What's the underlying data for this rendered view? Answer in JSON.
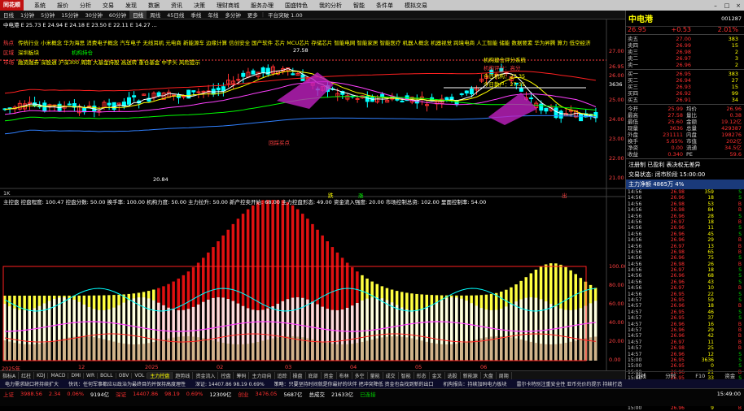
{
  "menubar": {
    "logo": "同花顺",
    "items": [
      "系统",
      "报价",
      "分析",
      "交易",
      "发现",
      "数据",
      "资讯",
      "决策",
      "理财商城",
      "服务办理",
      "国盛特色",
      "我的分析",
      "智能",
      "条件单",
      "模拟交易"
    ],
    "title": "中电港"
  },
  "toolbar": {
    "items": [
      "日线",
      "1分钟",
      "5分钟",
      "15分钟",
      "30分钟",
      "60分钟",
      "日线",
      "周线",
      "45日线",
      "季线",
      "年线",
      "多分钟",
      "更多"
    ],
    "stats": "中电港 E 25.73  E 24.94  E 24.18  E 23.50  E 22.11  E 14.27  ...",
    "status1": "扩: 22.86",
    "status2": "日 22.86",
    "status3": "平台突破 1.00"
  },
  "chart": {
    "labels": {
      "hot": "热点",
      "hot_value": "传统行业 小米概念 华为海思 消费电子概念 汽车电子 无线耳机 元电商 新能源车 边缘计算 信创安全 国产软件 芯片 MCU芯片 存储芯片 智能电网 智能家居 智能医疗 机器人概念 机器视觉 跨境电商 人工智能 储能 数据要素 华为昇腾 算力 低空经济",
      "zone": "区域",
      "zone_value": "深圳板块",
      "mkt": "融资融券 深股通 沪深300 周期 大基金持股 高送转 重仓基金 中字头 风险提示",
      "tag1": "融资融券",
      "tag2": "机构持仓",
      "box_title": "机构建仓评分系统",
      "box_l1": "机构评分：高分",
      "box_l2": "今日机构：27.35",
      "box_l3": "今日散户：27.35",
      "peak": "27.58",
      "low": "20.84",
      "buy_label": "买",
      "sell_label": "卖",
      "mid_label": "回踩买点",
      "scale": "1K",
      "sub_header": "主控盘 控盘程度: 100.47 控盘分数: 50.00 换手率: 100.00 机构力度: 50.00 主力拉升: 50.00 新产控卖开始: 68.00 主力控盘形态: 49.00 资金流入强度: 20.00 市场控制总资: 102.00 里面控制率: 54.00",
      "sub_a": "跌",
      "sub_b": "涨",
      "sub_c": "出"
    },
    "x_labels": [
      "2025年",
      "12",
      "2025",
      "02",
      "03",
      "04",
      "05",
      "06"
    ],
    "y_right": [
      "27.00",
      "26.00",
      "25.00",
      "24.00",
      "23.00",
      "22.00",
      "21.00"
    ],
    "y_right_extra": [
      "26.95",
      "3636"
    ],
    "sub_y": [
      "100.00",
      "80.00",
      "60.00",
      "40.00",
      "20.00",
      "0.00"
    ]
  },
  "bottomtabs": [
    "指标A",
    "红柱",
    "KDJ",
    "MACD",
    "DMI",
    "WR",
    "BOLL",
    "OBV",
    "VOL",
    "主力控盘",
    "趋势线",
    "资金流入",
    "控盘",
    "筹码",
    "主力动向",
    "追踪",
    "操盘",
    "底部",
    "资金",
    "布林",
    "多空",
    "量能",
    "成交",
    "智能",
    "形态",
    "金叉",
    "选股",
    "新能源",
    "大盘",
    "周期"
  ],
  "rightpanel": {
    "name": "中电港",
    "code": "001287",
    "price": "26.95",
    "change": "+0.53",
    "pct": "2.01%",
    "asks": [
      [
        "卖五",
        "27.00",
        "383"
      ],
      [
        "卖四",
        "26.99",
        "15"
      ],
      [
        "卖三",
        "26.98",
        "2"
      ],
      [
        "卖二",
        "26.97",
        "3"
      ],
      [
        "卖一",
        "26.96",
        "2"
      ]
    ],
    "bids": [
      [
        "买一",
        "26.95",
        "383"
      ],
      [
        "买二",
        "26.94",
        "27"
      ],
      [
        "买三",
        "26.93",
        "15"
      ],
      [
        "买四",
        "26.92",
        "99"
      ],
      [
        "买五",
        "26.91",
        "34"
      ]
    ],
    "kv": [
      [
        "今开",
        "25.99",
        "均价",
        "26.96"
      ],
      [
        "最高",
        "27.58",
        "量比",
        "0.38"
      ],
      [
        "最低",
        "25.60",
        "金额",
        "19.12亿"
      ],
      [
        "现量",
        "3636",
        "总量",
        "429387"
      ],
      [
        "外盘",
        "231111",
        "内盘",
        "198276"
      ],
      [
        "换手",
        "5.65%",
        "市值",
        "202亿"
      ],
      [
        "净资",
        "0.00",
        "流通",
        "34.5亿"
      ],
      [
        "收益",
        "0.340",
        "PE",
        "59.6"
      ]
    ],
    "notes": [
      "注册制 已盈利 表决权无差异",
      "交易状态: 闭市阶段 15:00:00",
      "主力净额 4865万 4%"
    ],
    "ticks": [
      [
        "14:56",
        "26.98",
        "359",
        "S"
      ],
      [
        "14:56",
        "26.96",
        "18",
        "S"
      ],
      [
        "14:56",
        "26.98",
        "53",
        "B"
      ],
      [
        "14:56",
        "26.98",
        "84",
        "B"
      ],
      [
        "14:56",
        "26.96",
        "28",
        "S"
      ],
      [
        "14:56",
        "26.97",
        "18",
        "B"
      ],
      [
        "14:56",
        "26.96",
        "11",
        "S"
      ],
      [
        "14:56",
        "26.96",
        "45",
        "S"
      ],
      [
        "14:56",
        "26.96",
        "29",
        "B"
      ],
      [
        "14:56",
        "26.97",
        "13",
        "B"
      ],
      [
        "14:56",
        "26.98",
        "65",
        "B"
      ],
      [
        "14:56",
        "26.96",
        "75",
        "S"
      ],
      [
        "14:56",
        "26.98",
        "26",
        "B"
      ],
      [
        "14:56",
        "26.97",
        "18",
        "S"
      ],
      [
        "14:56",
        "26.96",
        "68",
        "S"
      ],
      [
        "14:56",
        "26.96",
        "43",
        "S"
      ],
      [
        "14:56",
        "26.97",
        "10",
        "B"
      ],
      [
        "14:56",
        "26.95",
        "22",
        "S"
      ],
      [
        "14:57",
        "26.95",
        "59",
        "S"
      ],
      [
        "14:57",
        "26.96",
        "18",
        "B"
      ],
      [
        "14:57",
        "26.95",
        "46",
        "S"
      ],
      [
        "14:57",
        "26.95",
        "37",
        "S"
      ],
      [
        "14:57",
        "26.96",
        "16",
        "B"
      ],
      [
        "14:57",
        "26.96",
        "29",
        "B"
      ],
      [
        "14:57",
        "26.96",
        "42",
        "B"
      ],
      [
        "14:57",
        "26.97",
        "11",
        "B"
      ],
      [
        "14:57",
        "26.98",
        "25",
        "B"
      ],
      [
        "14:57",
        "26.96",
        "12",
        "S"
      ],
      [
        "15:00",
        "26.95",
        "3636",
        "S"
      ],
      [
        "15:00",
        "26.95",
        "0",
        "S"
      ],
      [
        "15:00",
        "26.96",
        "21",
        "B"
      ],
      [
        "15:00",
        "26.95",
        "33",
        "S"
      ],
      [
        "15:00",
        "26.95",
        "22",
        "S"
      ],
      [
        "15:00",
        "26.96",
        "40",
        "B"
      ],
      [
        "15:00",
        "26.95",
        "18",
        "S"
      ],
      [
        "15:00",
        "26.95",
        "27",
        "S"
      ],
      [
        "15:00",
        "26.96",
        "9",
        "B"
      ]
    ],
    "tabs": [
      "日线",
      "分时",
      "F10",
      "资金"
    ]
  },
  "newsbar": [
    "电力需求缺口将持续扩大",
    "快讯：任何军事都应以政治为最终目的并保持高度理性",
    "深证: 14407.86 98.19 0.69%",
    "策略：只要坚持时间就是你最好的伙伴 把冲突降低 资金也会找到新的出口",
    "机构报告：持续加码电力板块",
    "雷尔卡特别注重安全性 亚币兑价约提示 持续打造"
  ],
  "statusbar": {
    "r1": [
      [
        "上证",
        "3988.56",
        "2.34",
        "0.06%"
      ],
      [
        "9194亿",
        "深证",
        "14407.86",
        "98.19"
      ],
      [
        "0.69%",
        "12309亿",
        "创业",
        "3476.05"
      ],
      [
        "5687亿",
        "总成交",
        "21633亿",
        "已连接"
      ]
    ],
    "clock": "15:49:00"
  }
}
